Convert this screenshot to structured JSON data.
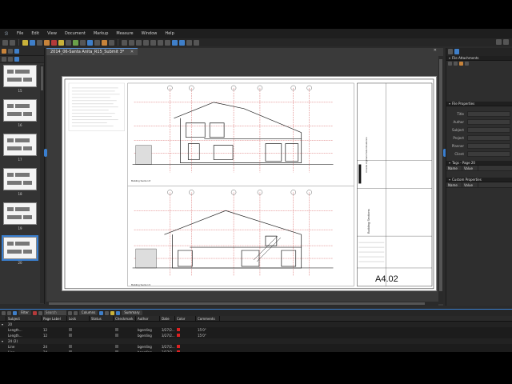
{
  "menu": {
    "logo": "ℬ",
    "items": [
      "File",
      "Edit",
      "View",
      "Document",
      "Markup",
      "Measure",
      "Window",
      "Help"
    ]
  },
  "document": {
    "tab_title": "2014_06-Santa Anita_R15_Submit 3*",
    "close": "✕",
    "sheet_number": "A4.02",
    "section_label_1": "Building Section 8",
    "section_label_2": "Building Section 9",
    "sheet_title": "Building Sections",
    "project_name": "Arcadia Highland Side Residence"
  },
  "thumbnails": [
    {
      "label": "15"
    },
    {
      "label": "16"
    },
    {
      "label": "17"
    },
    {
      "label": "18"
    },
    {
      "label": "19"
    },
    {
      "label": "20",
      "selected": true
    }
  ],
  "right_panel": {
    "attachments_header": "File Attachments",
    "properties_header": "File Properties",
    "properties": [
      {
        "key": "Title",
        "value": ""
      },
      {
        "key": "Author",
        "value": ""
      },
      {
        "key": "Subject",
        "value": ""
      },
      {
        "key": "Project",
        "value": ""
      },
      {
        "key": "Planner",
        "value": ""
      },
      {
        "key": "Client",
        "value": ""
      }
    ],
    "tags_header": "Tags - Page 20",
    "tags_cols": [
      "Name",
      "Value"
    ],
    "custom_header": "Custom Properties",
    "custom_cols": [
      "Name",
      "Value"
    ]
  },
  "markup_list": {
    "filter_label": "Filter",
    "search_placeholder": "Search",
    "columns_label": "Columns",
    "summary_label": "Summary",
    "headers": [
      "",
      "Subject",
      "Page Label",
      "Lock",
      "Status",
      "Checkmark",
      "Author",
      "Date",
      "Color",
      "Comments"
    ],
    "rows": [
      {
        "group": true,
        "subject": "20",
        "page": "",
        "author": "",
        "date": "",
        "comment": ""
      },
      {
        "subject": "Length...",
        "page": "12",
        "author": "bgerding",
        "date": "3/27/2...",
        "comment": "15'0\""
      },
      {
        "subject": "Length...",
        "page": "12",
        "author": "bgerding",
        "date": "3/27/2...",
        "comment": "15'0\""
      },
      {
        "group": true,
        "subject": "24 (2)",
        "page": "",
        "author": "",
        "date": "",
        "comment": ""
      },
      {
        "subject": "Line",
        "page": "24",
        "author": "bgerding",
        "date": "3/27/2...",
        "comment": ""
      },
      {
        "subject": "Line",
        "page": "24",
        "author": "bgerding",
        "date": "3/27/2...",
        "comment": ""
      }
    ]
  },
  "colors": {
    "accent": "#3a7fd0",
    "markup_red": "#dd2222"
  }
}
